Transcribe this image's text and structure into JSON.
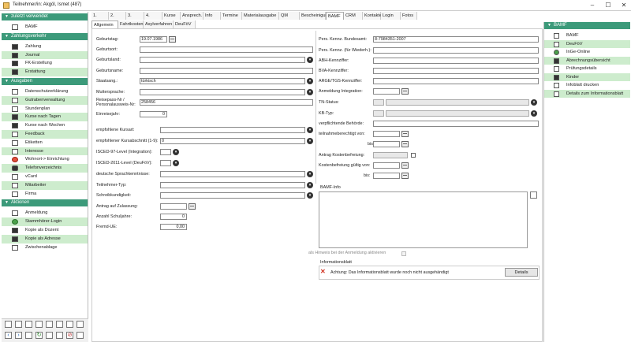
{
  "window": {
    "title": "Teilnehmer/in: Akgöl, Ismet (487)"
  },
  "left": {
    "sections": [
      {
        "title": "zuletzt verwendet",
        "items": [
          {
            "label": "BAMF",
            "green": false
          }
        ]
      },
      {
        "title": "Zahlungsverkehr",
        "items": [
          {
            "label": "Zahlung",
            "green": false
          },
          {
            "label": "Journal",
            "green": true
          },
          {
            "label": "FK-Erstellung",
            "green": false
          },
          {
            "label": "Erstattung",
            "green": true
          }
        ]
      },
      {
        "title": "Ausgaben",
        "items": [
          {
            "label": "Datenschutzerklärung",
            "green": false
          },
          {
            "label": "Gutrabenverwaltung",
            "green": true
          },
          {
            "label": "Stundenplan",
            "green": false
          },
          {
            "label": "Kurse nach Tagen",
            "green": true
          },
          {
            "label": "Kurse nach Wochen",
            "green": false
          },
          {
            "label": "Feedback",
            "green": true
          },
          {
            "label": "Etiketten",
            "green": false
          },
          {
            "label": "Interesse",
            "green": true
          },
          {
            "label": "Wohnort-> Einrichtung",
            "green": false
          },
          {
            "label": "Telefonverzeichnis",
            "green": true
          },
          {
            "label": "vCard",
            "green": false
          },
          {
            "label": "Mitarbeiter",
            "green": true
          },
          {
            "label": "Firma",
            "green": false
          }
        ]
      },
      {
        "title": "Aktionen",
        "items": [
          {
            "label": "Anmeldung",
            "green": false
          },
          {
            "label": "Stammhörer-Login",
            "green": true
          },
          {
            "label": "Kopie als Dozent",
            "green": false
          },
          {
            "label": "Kopie als Adresse",
            "green": true
          },
          {
            "label": "Zwischenablage",
            "green": false
          }
        ]
      }
    ]
  },
  "tabs_top": [
    "1.",
    "2.",
    "3.",
    "4.",
    "Kurse",
    "Ansprech.",
    "Info",
    "Termine",
    "Materialausgabe",
    "QM",
    "Bescheinigungen",
    "BAMF",
    "CRM",
    "Kontakte",
    "Login",
    "Fotos"
  ],
  "tabs_sub": [
    "Allgemein",
    "Fahrtkosten",
    "Asylverfahren",
    "DeuFöV"
  ],
  "form_left": {
    "geburtstag_label": "Geburtstag:",
    "geburtstag_value": "19.07.1986",
    "geburtsort_label": "Geburtsort:",
    "geburtsland_label": "Geburtsland:",
    "geburtsname_label": "Geburtsname:",
    "staatsang_label": "Staatsang.:",
    "staatsang_value": "türkisch",
    "muttersprache_label": "Muttersprache:",
    "reisepass_label1": "Reisepass-Nr /",
    "reisepass_label2": "Personalausweis-Nr:",
    "reisepass_value": "258456",
    "einreisejahr_label": "Einreisejahr:",
    "einreisejahr_value": "0",
    "kursart_label": "empfohlene Kursart:",
    "kursabschnitt_label": "empfohlener Kursabschnitt (1-9):",
    "kursabschnitt_value": "0",
    "isced97_label": "ISCED-97-Level (Integration):",
    "isced2011_label": "ISCED-2011-Level (DeuFöV):",
    "sprachkenntnisse_label": "deutsche Sprachkenntnisse:",
    "teilnehmertyp_label": "Teilnehmer-Typ:",
    "schreibkundigkeit_label": "Schreibkundigkeit:",
    "antrag_label": "Antrag auf Zulassung:",
    "schuljahre_label": "Anzahl Schuljahre:",
    "schuljahre_value": "0",
    "fremdue_label": "Fremd-UE:",
    "fremdue_value": "0,00"
  },
  "form_right": {
    "perskennz_label": "Pers. Kennz. Bundesamt:",
    "perskennz_value": "8-7984351-2007",
    "perskennz_wieder_label": "Pers. Kennz. (für Wiederh.):",
    "abh_label": "ABH-Kennziffer:",
    "bva_label": "BVA-Kennziffer:",
    "arge_label": "ARGE/TGS-Kennziffer:",
    "anmeldung_label": "Anmeldung Integration:",
    "tnstatus_label": "TN-Status:",
    "kbtyp_label": "KB-Typ:",
    "behoerde_label": "verpflichtende Behörde:",
    "berechtigt_label": "teilnahmeberechtigt von:",
    "bis_label": "bis:",
    "kostenbefreiung_label": "Antrag Kostenbefreiung:",
    "befreiung_von_label": "Kostenbefreiung gültig von:",
    "bis2_label": "bis:"
  },
  "bamf_info": {
    "title": "BAMF-Info",
    "hinweis_label": "als Hinweis bei der Anmeldung aktivieren"
  },
  "infoblatt": {
    "title": "Informationsblatt",
    "message": "Achtung: Das Informationsblatt wurde noch nicht ausgehändigt",
    "details_button": "Details"
  },
  "right": {
    "title": "BAMF",
    "items": [
      {
        "label": "BAMF",
        "green": false
      },
      {
        "label": "DeuFöV",
        "green": true
      },
      {
        "label": "InGe-Online",
        "green": false
      },
      {
        "label": "Abrechnungsübersicht",
        "green": true
      },
      {
        "label": "Prüfungsdetails",
        "green": false
      },
      {
        "label": "Kinder",
        "green": true
      },
      {
        "label": "Infoblatt drucken",
        "green": false
      },
      {
        "label": "Details zum Informationsblatt",
        "green": true
      }
    ]
  },
  "colors": {
    "accent": "#3c9a7a",
    "row_highlight": "#cdeccd"
  }
}
